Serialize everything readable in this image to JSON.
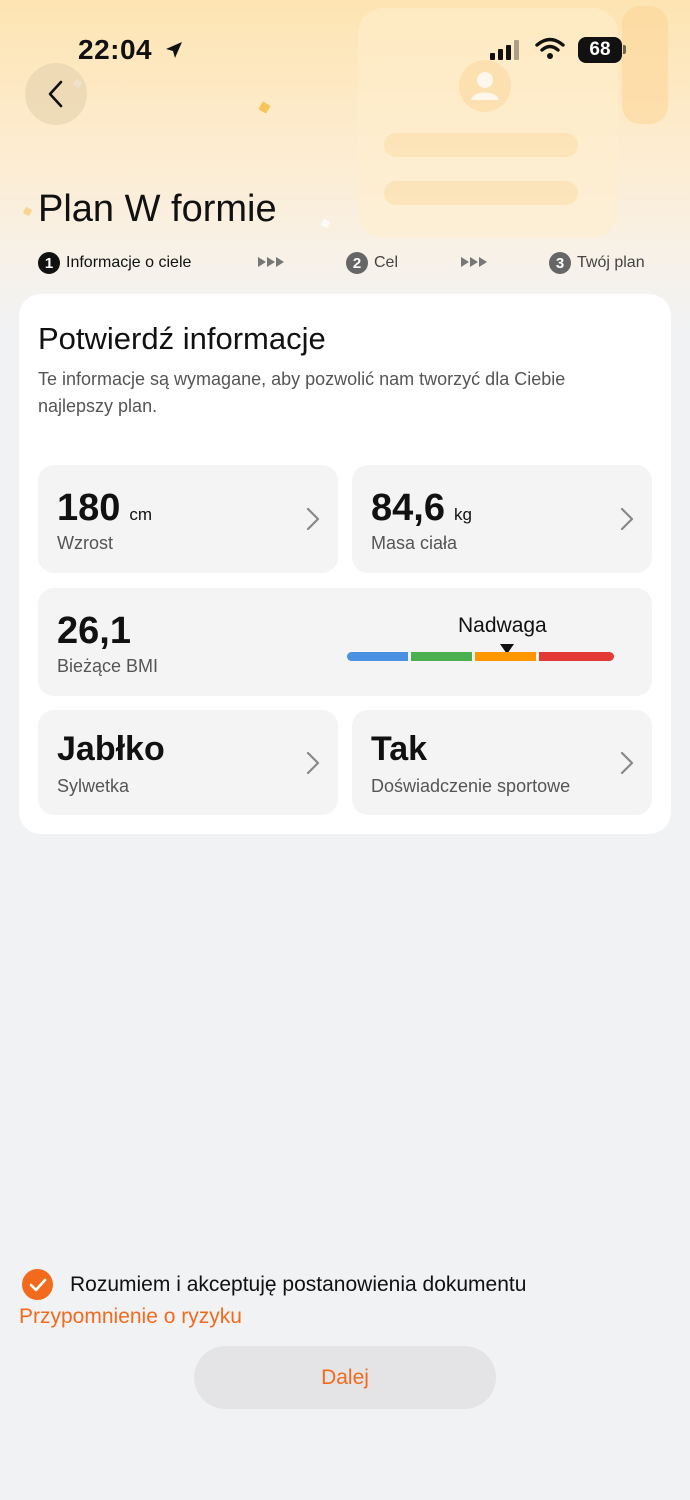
{
  "status_bar": {
    "time": "22:04",
    "battery": "68",
    "icons": [
      "location-arrow-icon",
      "signal-icon",
      "wifi-icon",
      "battery-icon"
    ]
  },
  "header": {
    "back_icon": "chevron-left-icon",
    "title": "Plan W formie"
  },
  "steps": [
    {
      "number": "1",
      "label": "Informacje o ciele",
      "active": true
    },
    {
      "number": "2",
      "label": "Cel",
      "active": false
    },
    {
      "number": "3",
      "label": "Twój plan",
      "active": false
    }
  ],
  "card": {
    "title": "Potwierdź informacje",
    "description": "Te informacje są wymagane, aby pozwolić nam tworzyć dla Ciebie najlepszy plan.",
    "height": {
      "value": "180",
      "unit": "cm",
      "label": "Wzrost"
    },
    "weight": {
      "value": "84,6",
      "unit": "kg",
      "label": "Masa ciała"
    },
    "bmi": {
      "value": "26,1",
      "label": "Bieżące BMI",
      "status": "Nadwaga",
      "scale_colors": [
        "#4a90e2",
        "#4caf50",
        "#ff9800",
        "#e53935"
      ],
      "active_segment": 3
    },
    "body_shape": {
      "value": "Jabłko",
      "label": "Sylwetka"
    },
    "sport_experience": {
      "value": "Tak",
      "label": "Doświadczenie sportowe"
    }
  },
  "consent": {
    "checked": true,
    "text": "Rozumiem i akceptuję postanowienia dokumentu",
    "link": "Przypomnienie o ryzyku"
  },
  "next_button": "Dalej",
  "colors": {
    "accent": "#f26b1d",
    "background": "#f1f2f4",
    "hero_gradient_top": "#fde4b2"
  }
}
